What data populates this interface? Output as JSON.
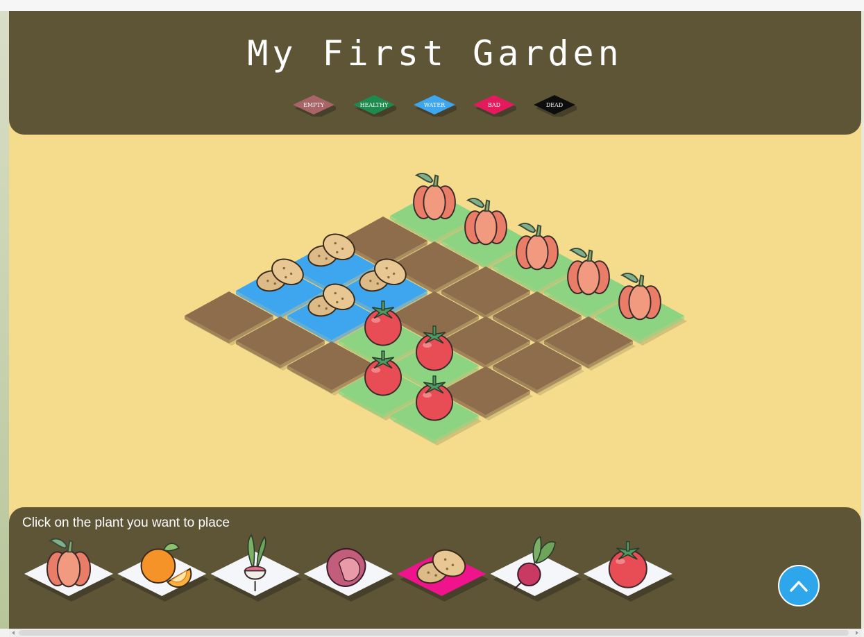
{
  "header": {
    "title": "My First Garden",
    "legend": [
      {
        "id": "empty",
        "label": "empty",
        "color": "#a86466"
      },
      {
        "id": "healthy",
        "label": "healthy",
        "color": "#1f8a4e"
      },
      {
        "id": "water",
        "label": "water",
        "color": "#3ea6ee"
      },
      {
        "id": "bad",
        "label": "bad",
        "color": "#e51a5c"
      },
      {
        "id": "dead",
        "label": "dead",
        "color": "#0d0d0d"
      }
    ]
  },
  "garden": {
    "colors": {
      "empty": "#8d6d4b",
      "healthy": "#8cd482",
      "water": "#3ea6ee"
    },
    "grid_size": 5,
    "tiles": [
      {
        "row": 0,
        "col": 0,
        "state": "healthy",
        "plant": "pumpkin"
      },
      {
        "row": 0,
        "col": 1,
        "state": "healthy",
        "plant": "pumpkin"
      },
      {
        "row": 0,
        "col": 2,
        "state": "healthy",
        "plant": "pumpkin"
      },
      {
        "row": 0,
        "col": 3,
        "state": "healthy",
        "plant": "pumpkin"
      },
      {
        "row": 0,
        "col": 4,
        "state": "healthy",
        "plant": "pumpkin"
      },
      {
        "row": 1,
        "col": 0,
        "state": "empty",
        "plant": ""
      },
      {
        "row": 1,
        "col": 1,
        "state": "empty",
        "plant": ""
      },
      {
        "row": 1,
        "col": 2,
        "state": "empty",
        "plant": ""
      },
      {
        "row": 1,
        "col": 3,
        "state": "empty",
        "plant": ""
      },
      {
        "row": 1,
        "col": 4,
        "state": "empty",
        "plant": ""
      },
      {
        "row": 2,
        "col": 0,
        "state": "water",
        "plant": "potato"
      },
      {
        "row": 2,
        "col": 1,
        "state": "water",
        "plant": "potato"
      },
      {
        "row": 2,
        "col": 2,
        "state": "empty",
        "plant": ""
      },
      {
        "row": 2,
        "col": 3,
        "state": "empty",
        "plant": ""
      },
      {
        "row": 2,
        "col": 4,
        "state": "empty",
        "plant": ""
      },
      {
        "row": 3,
        "col": 0,
        "state": "water",
        "plant": "potato"
      },
      {
        "row": 3,
        "col": 1,
        "state": "water",
        "plant": "potato"
      },
      {
        "row": 3,
        "col": 2,
        "state": "healthy",
        "plant": "tomato"
      },
      {
        "row": 3,
        "col": 3,
        "state": "healthy",
        "plant": "tomato"
      },
      {
        "row": 3,
        "col": 4,
        "state": "empty",
        "plant": ""
      },
      {
        "row": 4,
        "col": 0,
        "state": "empty",
        "plant": ""
      },
      {
        "row": 4,
        "col": 1,
        "state": "empty",
        "plant": ""
      },
      {
        "row": 4,
        "col": 2,
        "state": "empty",
        "plant": ""
      },
      {
        "row": 4,
        "col": 3,
        "state": "healthy",
        "plant": "tomato"
      },
      {
        "row": 4,
        "col": 4,
        "state": "healthy",
        "plant": "tomato"
      }
    ]
  },
  "tray": {
    "prompt": "Click on the plant you want to place",
    "items": [
      {
        "plant": "pumpkin",
        "selected": false
      },
      {
        "plant": "orange",
        "selected": false
      },
      {
        "plant": "radish",
        "selected": false
      },
      {
        "plant": "sweet-potato",
        "selected": false
      },
      {
        "plant": "potato",
        "selected": true
      },
      {
        "plant": "beetroot",
        "selected": false
      },
      {
        "plant": "tomato",
        "selected": false
      }
    ],
    "selected_color": "#f0148c",
    "tile_color": "#f4f6fa"
  },
  "icons": {
    "scroll_top": "chevron-up-icon"
  }
}
